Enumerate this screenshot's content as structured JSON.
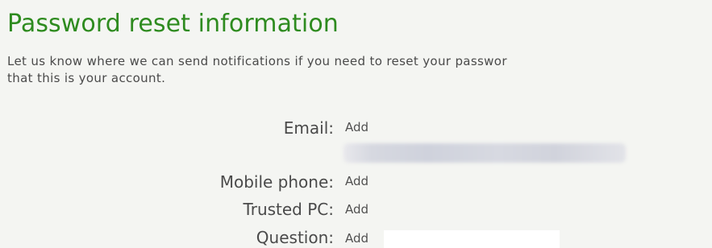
{
  "section": {
    "title": "Password reset information",
    "description_line1": "Let us know where we can send notifications if you need to reset your passwor",
    "description_line2": "that this is your account."
  },
  "fields": {
    "email": {
      "label": "Email:",
      "action": "Add"
    },
    "mobile": {
      "label": "Mobile phone:",
      "action": "Add"
    },
    "trusted_pc": {
      "label": "Trusted PC:",
      "action": "Add"
    },
    "question": {
      "label": "Question:",
      "action": "Add"
    }
  }
}
